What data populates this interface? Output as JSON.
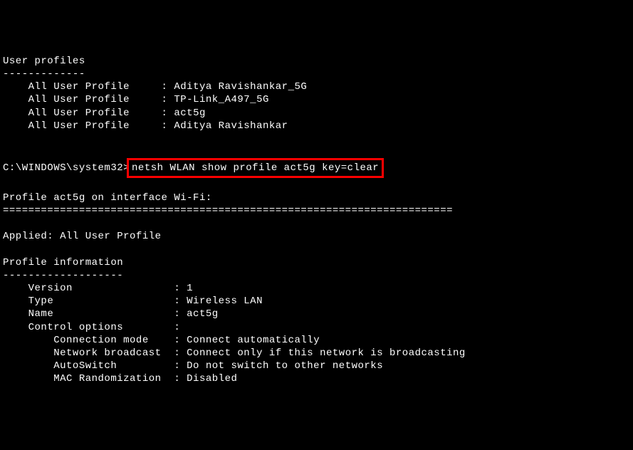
{
  "header": "User profiles",
  "header_dashes": "-------------",
  "profiles": [
    {
      "label": "All User Profile",
      "colon": ":",
      "value": "Aditya Ravishankar_5G"
    },
    {
      "label": "All User Profile",
      "colon": ":",
      "value": "TP-Link_A497_5G"
    },
    {
      "label": "All User Profile",
      "colon": ":",
      "value": "act5g"
    },
    {
      "label": "All User Profile",
      "colon": ":",
      "value": "Aditya Ravishankar"
    }
  ],
  "prompt": "C:\\WINDOWS\\system32>",
  "command": "netsh WLAN show profile act5g key=clear",
  "interface_line": "Profile act5g on interface Wi-Fi:",
  "equals_line": "=======================================================================",
  "applied_line": "Applied: All User Profile",
  "profile_info_header": "Profile information",
  "profile_info_dashes": "-------------------",
  "info": {
    "version_label": "Version",
    "version_value": "1",
    "type_label": "Type",
    "type_value": "Wireless LAN",
    "name_label": "Name",
    "name_value": "act5g",
    "control_options_label": "Control options",
    "connection_mode_label": "Connection mode",
    "connection_mode_value": "Connect automatically",
    "network_broadcast_label": "Network broadcast",
    "network_broadcast_value": "Connect only if this network is broadcasting",
    "autoswitch_label": "AutoSwitch",
    "autoswitch_value": "Do not switch to other networks",
    "mac_randomization_label": "MAC Randomization",
    "mac_randomization_value": "Disabled"
  }
}
